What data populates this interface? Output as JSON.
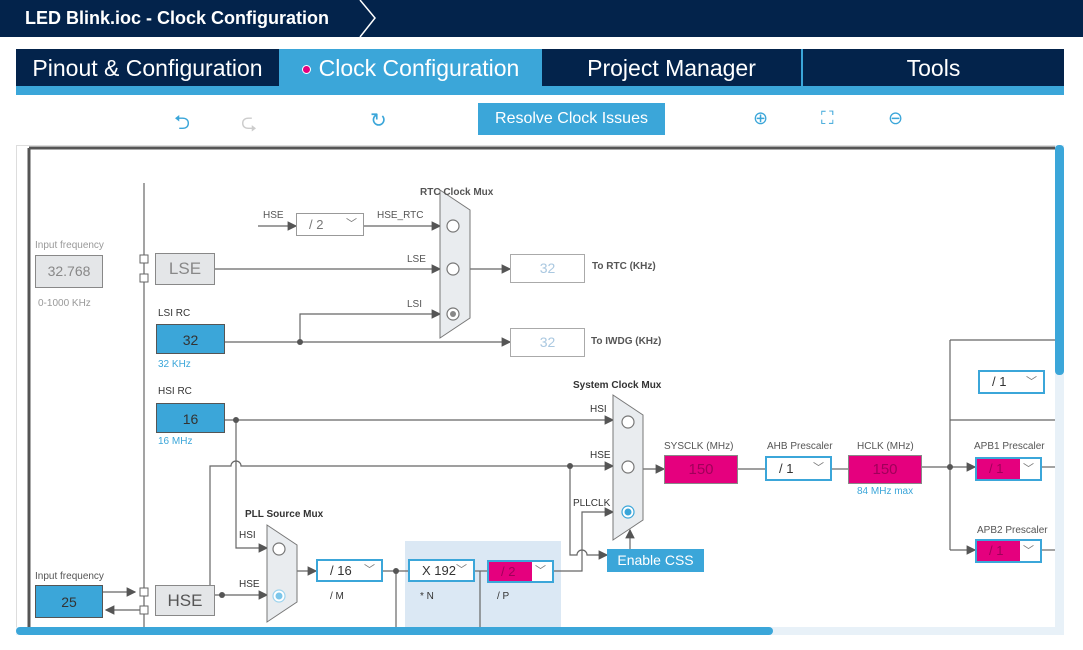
{
  "window": {
    "title": "LED Blink.ioc - Clock Configuration"
  },
  "tabs": [
    {
      "label": "Pinout & Configuration"
    },
    {
      "label": "Clock Configuration",
      "active": true
    },
    {
      "label": "Project Manager"
    },
    {
      "label": "Tools"
    }
  ],
  "toolbar": {
    "resolve_label": "Resolve Clock Issues",
    "icons": [
      "undo-icon",
      "redo-icon",
      "refresh-icon",
      "zoom-in-icon",
      "fit-icon",
      "zoom-out-icon"
    ]
  },
  "diagram": {
    "lse_input": {
      "label": "Input frequency",
      "value": "32.768",
      "range": "0-1000 KHz"
    },
    "lse": "LSE",
    "lsi": {
      "label": "LSI RC",
      "value": "32",
      "unit": "32 KHz"
    },
    "hsi": {
      "label": "HSI RC",
      "value": "16",
      "unit": "16 MHz"
    },
    "hse_input": {
      "label": "Input frequency",
      "value": "25"
    },
    "hse": "HSE",
    "rtc_mux": {
      "title": "RTC Clock Mux",
      "hse_label": "HSE",
      "hse_div": "/ 2",
      "hse_rtc": "HSE_RTC",
      "lse_label": "LSE",
      "lsi_label": "LSI"
    },
    "to_rtc": {
      "value": "32",
      "label": "To RTC (KHz)"
    },
    "to_iwdg": {
      "value": "32",
      "label": "To IWDG (KHz)"
    },
    "sys_mux": {
      "title": "System Clock Mux",
      "hsi": "HSI",
      "hse": "HSE",
      "pllclk": "PLLCLK"
    },
    "enable_css": "Enable CSS",
    "sysclk": {
      "label": "SYSCLK (MHz)",
      "value": "150"
    },
    "ahb": {
      "label": "AHB Prescaler",
      "value": "/ 1"
    },
    "hclk": {
      "label": "HCLK (MHz)",
      "value": "150",
      "max": "84 MHz max"
    },
    "top_prescaler": {
      "value": "/ 1"
    },
    "apb1": {
      "label": "APB1 Prescaler",
      "value": "/ 1"
    },
    "apb2": {
      "label": "APB2 Prescaler",
      "value": "/ 1"
    },
    "pll_mux": {
      "title": "PLL Source Mux",
      "hsi": "HSI",
      "hse": "HSE"
    },
    "pll_m": {
      "value": "/ 16",
      "label": "/ M"
    },
    "pll_n": {
      "value": "X 192",
      "label": "* N"
    },
    "pll_p": {
      "value": "/ 2",
      "label": "/ P"
    }
  },
  "colors": {
    "navy": "#03234b",
    "accent": "#3ba6d9",
    "error": "#e5007e"
  }
}
